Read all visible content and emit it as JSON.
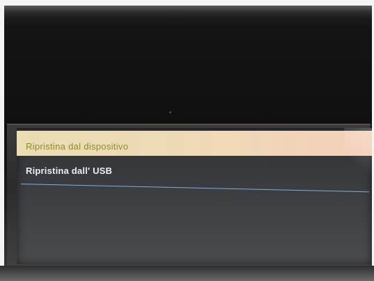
{
  "menu": {
    "items": [
      {
        "label": "Ripristina dal dispositivo",
        "selected": true
      },
      {
        "label": "Ripristina dall' USB",
        "selected": false
      }
    ]
  },
  "colors": {
    "selected_background": "#eaddb2",
    "selected_text": "#8b8d28",
    "normal_text": "#e9eef8",
    "separator": "#7fb0d8",
    "screen_background": "#3a3c3f"
  }
}
